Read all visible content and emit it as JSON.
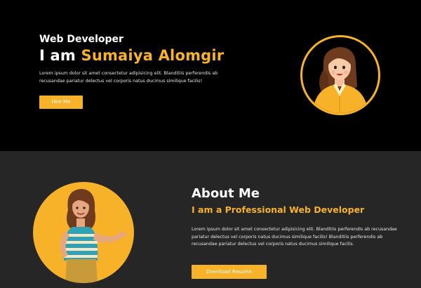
{
  "hero": {
    "role": "Web Developer",
    "greeting": "I am ",
    "name": "Sumaiya Alomgir",
    "description": "Lorem ipsum dolor sit amet consectetur adipisicing elit. Blanditiis perferendis ab recusandae pariatur delectus vel corporis natus ducimus similique facilis!",
    "button_label": "Hire Me"
  },
  "about": {
    "title": "About Me",
    "subtitle": "I am a Professional Web Developer",
    "description": "Lorem ipsum dolor sit amet consectetur adipisicing elit. Blanditiis perferendis ab recusandae pariatur delectus vel corporis natus ducimus similique facilis! Blanditiis perferendis ab recusandae pariatur delectus vel corporis natus ducimus similique facilis.",
    "button_label": "Download Resume"
  },
  "colors": {
    "accent": "#f7b22a",
    "hero_background": "#000000",
    "about_background": "#262626"
  },
  "icons": {
    "hero_avatar": "woman-avatar-illustration",
    "about_avatar": "woman-presenting-illustration"
  }
}
